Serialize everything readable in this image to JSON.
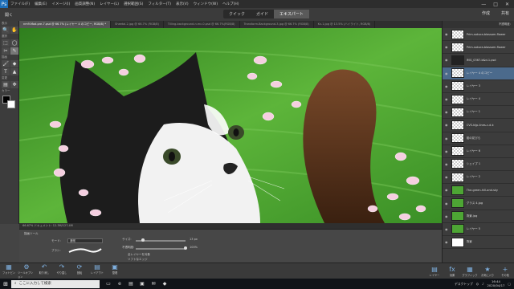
{
  "menubar": {
    "logo": "Ps",
    "items": [
      "ファイル(F)",
      "編集(E)",
      "イメージ(I)",
      "画質調整(N)",
      "レイヤー(L)",
      "選択範囲(S)",
      "フィルター(T)",
      "表示(V)",
      "ウィンドウ(W)",
      "ヘルプ(H)"
    ],
    "window_controls": [
      "—",
      "□",
      "✕"
    ]
  },
  "topbar": {
    "open_label": "開く",
    "modes": [
      "クイック",
      "ガイド",
      "エキスパート"
    ],
    "active_mode": "エキスパート",
    "create_label": "作成",
    "share_label": "共有"
  },
  "doc_tabs": [
    "nm9.Mod.pre-7.psd @ 66.7% (レイヤー 4 のコピー, RGB/8) *",
    "Sheetal.2.jpg @ 66.7% (RGB/8)",
    "Tilling-background-n.mc-0.psd @ 66.7%(RGB/8)",
    "Transform-Background-3.jpg @ 66.7% (RGB/8)",
    "Kv-1.jpg @ 13.5% (ハイライト, RGB/8)"
  ],
  "toolbox": {
    "groups": [
      "表示",
      "選択",
      "描画",
      "変更",
      "カラー"
    ],
    "tools": [
      "🔍",
      "✋",
      "⬚",
      "◯",
      "✂",
      "✎",
      "🖌",
      "◆",
      "T",
      "▲",
      "▤",
      "✥"
    ]
  },
  "statusbar": {
    "text": "66.67% ドキュメント: 12.3M/127.4M"
  },
  "tool_options": {
    "title": "描画ツール",
    "mode_label": "モード:",
    "mode_value": "通常",
    "brush_label": "ブラシ:",
    "size_label": "サイズ:",
    "size_value": "13 px",
    "size_fraction": 0.15,
    "opacity_label": "不透明度:",
    "opacity_value": "100%",
    "opacity_fraction": 1.0,
    "check1": "全レイヤーを対象",
    "check2": "ソフトなエッジ"
  },
  "layers": {
    "head": "不透明度:",
    "items": [
      {
        "name": "Prim-sakura-blossom-flower",
        "active": false,
        "thumb": "checker"
      },
      {
        "name": "Prim-sakura-blossom-flower",
        "active": false,
        "thumb": "checker"
      },
      {
        "name": "IMG_0367-b&d-1.psd",
        "active": false,
        "thumb": "dark"
      },
      {
        "name": "レイヤー 4 のコピー",
        "active": true,
        "thumb": "checker"
      },
      {
        "name": "レイヤー 3",
        "active": false,
        "thumb": "checker"
      },
      {
        "name": "レイヤー 4",
        "active": false,
        "thumb": "checker"
      },
      {
        "name": "レイヤー 1",
        "active": false,
        "thumb": "checker"
      },
      {
        "name": "CVS-kijp-lines-c-d-k",
        "active": false,
        "thumb": "checker"
      },
      {
        "name": "桜の花びら",
        "active": false,
        "thumb": "checker"
      },
      {
        "name": "レイヤー 6",
        "active": false,
        "thumb": "checker"
      },
      {
        "name": "シェイプ 1",
        "active": false,
        "thumb": "checker"
      },
      {
        "name": "レイヤー 2",
        "active": false,
        "thumb": "checker"
      },
      {
        "name": "The-green-hill-and-sky",
        "active": false,
        "thumb": "green"
      },
      {
        "name": "グラス 4.jpg",
        "active": false,
        "thumb": "green"
      },
      {
        "name": "背景.jpg",
        "active": false,
        "thumb": "green"
      },
      {
        "name": "レイヤー 5",
        "active": false,
        "thumb": "green"
      },
      {
        "name": "背景",
        "active": false,
        "thumb": "white"
      }
    ]
  },
  "bottombar": {
    "left": [
      {
        "icon": "▦",
        "label": "フォトビン"
      },
      {
        "icon": "⚙",
        "label": "ツールオプション"
      },
      {
        "icon": "↶",
        "label": "取り消し"
      },
      {
        "icon": "↷",
        "label": "やり直し"
      },
      {
        "icon": "⟳",
        "label": "回転"
      },
      {
        "icon": "▤",
        "label": "レイアウト"
      },
      {
        "icon": "▣",
        "label": "整理"
      }
    ],
    "right": [
      {
        "icon": "▤",
        "label": "レイヤー"
      },
      {
        "icon": "fx",
        "label": "効果"
      },
      {
        "icon": "▦",
        "label": "グラフィック"
      },
      {
        "icon": "★",
        "label": "お気に入り"
      },
      {
        "icon": "+",
        "label": "その他"
      }
    ]
  },
  "taskbar": {
    "search_placeholder": "ここに入力して検索",
    "tray_text": "デスクトップ",
    "time": "16:44",
    "date": "2020/04/17"
  },
  "colors": {
    "accent": "#1e6fb8",
    "active_layer": "#4b6a8c",
    "canvas_grass": "#3e9a2a"
  }
}
